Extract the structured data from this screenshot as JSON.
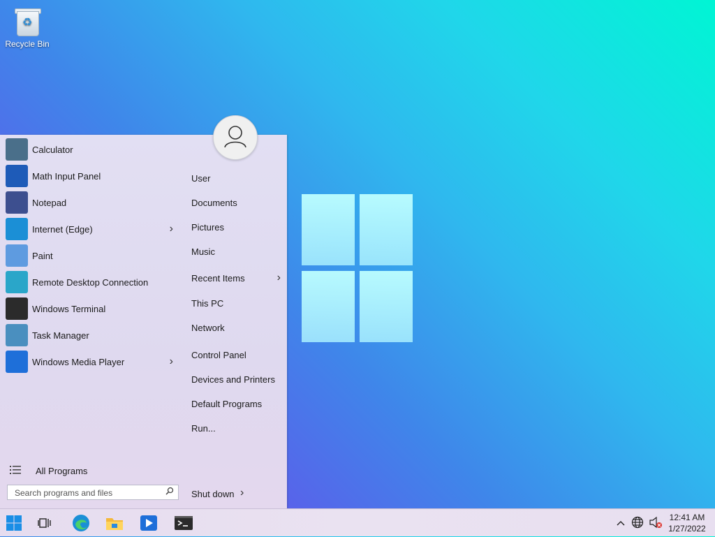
{
  "desktop": {
    "recycle_bin_label": "Recycle Bin"
  },
  "start_menu": {
    "apps": [
      {
        "label": "Calculator",
        "icon": "calculator-icon",
        "color": "#4a6f8a",
        "submenu": false
      },
      {
        "label": "Math Input Panel",
        "icon": "math-input-icon",
        "color": "#1e5bb8",
        "submenu": false
      },
      {
        "label": "Notepad",
        "icon": "notepad-icon",
        "color": "#3d4f8f",
        "submenu": false
      },
      {
        "label": "Internet (Edge)",
        "icon": "edge-icon",
        "color": "#1b8fd6",
        "submenu": true
      },
      {
        "label": "Paint",
        "icon": "paint-icon",
        "color": "#5e9be0",
        "submenu": false
      },
      {
        "label": "Remote Desktop Connection",
        "icon": "remote-desktop-icon",
        "color": "#2aa6c9",
        "submenu": false
      },
      {
        "label": "Windows Terminal",
        "icon": "terminal-icon",
        "color": "#2b2b2b",
        "submenu": false
      },
      {
        "label": "Task Manager",
        "icon": "task-manager-icon",
        "color": "#4a8fbf",
        "submenu": false
      },
      {
        "label": "Windows Media Player",
        "icon": "media-player-icon",
        "color": "#1e6fd9",
        "submenu": true
      }
    ],
    "links": [
      {
        "label": "User",
        "submenu": false
      },
      {
        "label": "Documents",
        "submenu": false
      },
      {
        "label": "Pictures",
        "submenu": false
      },
      {
        "label": "Music",
        "submenu": false
      },
      {
        "label": "Recent Items",
        "submenu": true
      },
      {
        "label": "This PC",
        "submenu": false
      },
      {
        "label": "Network",
        "submenu": false
      },
      {
        "label": "Control Panel",
        "submenu": false
      },
      {
        "label": "Devices and Printers",
        "submenu": false
      },
      {
        "label": "Default Programs",
        "submenu": false
      },
      {
        "label": "Run...",
        "submenu": false
      }
    ],
    "all_programs_label": "All Programs",
    "search_placeholder": "Search programs and files",
    "shutdown_label": "Shut down",
    "submenu_arrow": "›"
  },
  "taskbar": {
    "icons": [
      "start-icon",
      "task-view-icon",
      "edge-icon",
      "file-explorer-icon",
      "media-player-icon",
      "terminal-icon"
    ],
    "clock_time": "12:41 AM",
    "clock_date": "1/27/2022"
  }
}
